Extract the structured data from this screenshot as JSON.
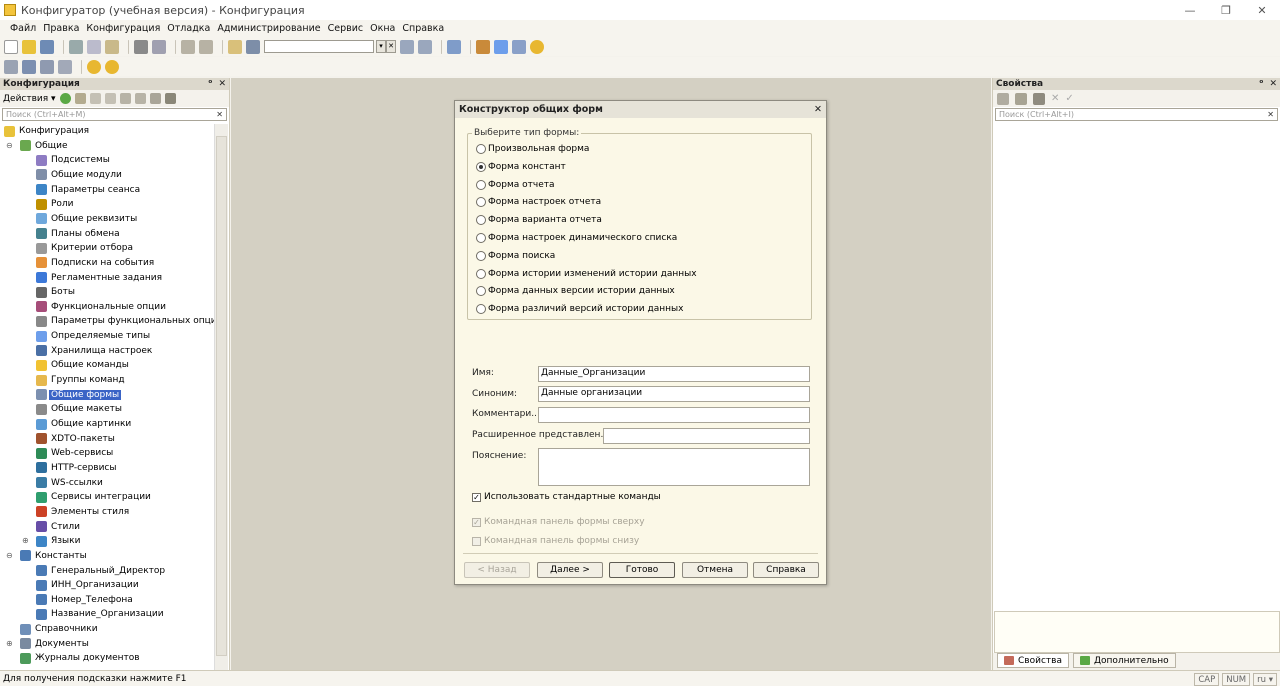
{
  "app": {
    "title": "Конфигуратор (учебная версия) - Конфигурация",
    "controls": [
      "—",
      "❐",
      "✕"
    ]
  },
  "menu": [
    "Файл",
    "Правка",
    "Конфигурация",
    "Отладка",
    "Администрирование",
    "Сервис",
    "Окна",
    "Справка"
  ],
  "left_panel": {
    "title": "Конфигурация",
    "actions_label": "Действия ▾",
    "search_placeholder": "Поиск (Ctrl+Alt+M)",
    "tree": [
      {
        "label": "Конфигурация",
        "level": 0,
        "icon": "config-icon",
        "color": "#e8c23a"
      },
      {
        "label": "Общие",
        "level": 1,
        "icon": "common-icon",
        "color": "#6aa84f",
        "exp": "⊖"
      },
      {
        "label": "Подсистемы",
        "level": 2,
        "icon": "subsystems-icon",
        "color": "#8e7cc3"
      },
      {
        "label": "Общие модули",
        "level": 2,
        "icon": "module-icon",
        "color": "#7f8ea8"
      },
      {
        "label": "Параметры сеанса",
        "level": 2,
        "icon": "session-params-icon",
        "color": "#3d85c6"
      },
      {
        "label": "Роли",
        "level": 2,
        "icon": "roles-icon",
        "color": "#bf9000"
      },
      {
        "label": "Общие реквизиты",
        "level": 2,
        "icon": "attributes-icon",
        "color": "#6fa8dc"
      },
      {
        "label": "Планы обмена",
        "level": 2,
        "icon": "exchange-icon",
        "color": "#45818e"
      },
      {
        "label": "Критерии отбора",
        "level": 2,
        "icon": "filter-criteria-icon",
        "color": "#999999"
      },
      {
        "label": "Подписки на события",
        "level": 2,
        "icon": "subscriptions-icon",
        "color": "#e69138"
      },
      {
        "label": "Регламентные задания",
        "level": 2,
        "icon": "scheduled-jobs-icon",
        "color": "#3c78d8"
      },
      {
        "label": "Боты",
        "level": 2,
        "icon": "bots-icon",
        "color": "#666666"
      },
      {
        "label": "Функциональные опции",
        "level": 2,
        "icon": "functional-options-icon",
        "color": "#a64d79"
      },
      {
        "label": "Параметры функциональных опций",
        "level": 2,
        "icon": "fo-params-icon",
        "color": "#888888"
      },
      {
        "label": "Определяемые типы",
        "level": 2,
        "icon": "defined-types-icon",
        "color": "#6d9eeb"
      },
      {
        "label": "Хранилища настроек",
        "level": 2,
        "icon": "settings-storage-icon",
        "color": "#4a6fa5"
      },
      {
        "label": "Общие команды",
        "level": 2,
        "icon": "commands-icon",
        "color": "#f1c232"
      },
      {
        "label": "Группы команд",
        "level": 2,
        "icon": "command-groups-icon",
        "color": "#e6b84d"
      },
      {
        "label": "Общие формы",
        "level": 2,
        "icon": "forms-icon",
        "color": "#7c90b0",
        "selected": true
      },
      {
        "label": "Общие макеты",
        "level": 2,
        "icon": "templates-icon",
        "color": "#8a8a8a"
      },
      {
        "label": "Общие картинки",
        "level": 2,
        "icon": "pictures-icon",
        "color": "#5b9bd5"
      },
      {
        "label": "XDTO-пакеты",
        "level": 2,
        "icon": "xdto-icon",
        "color": "#a0522d"
      },
      {
        "label": "Web-сервисы",
        "level": 2,
        "icon": "web-services-icon",
        "color": "#2e8b57"
      },
      {
        "label": "HTTP-сервисы",
        "level": 2,
        "icon": "http-services-icon",
        "color": "#2e6f9e"
      },
      {
        "label": "WS-ссылки",
        "level": 2,
        "icon": "ws-links-icon",
        "color": "#3a7ca5"
      },
      {
        "label": "Сервисы интеграции",
        "level": 2,
        "icon": "integration-icon",
        "color": "#2f9e6e"
      },
      {
        "label": "Элементы стиля",
        "level": 2,
        "icon": "style-items-icon",
        "color": "#cc4125"
      },
      {
        "label": "Стили",
        "level": 2,
        "icon": "styles-icon",
        "color": "#674ea7"
      },
      {
        "label": "Языки",
        "level": 2,
        "icon": "languages-icon",
        "color": "#3d85c6",
        "exp": "⊕"
      },
      {
        "label": "Константы",
        "level": 1,
        "icon": "constants-icon",
        "color": "#4a7ab5",
        "exp": "⊖"
      },
      {
        "label": "Генеральный_Директор",
        "level": 2,
        "icon": "constant-icon",
        "color": "#4a7ab5"
      },
      {
        "label": "ИНН_Организации",
        "level": 2,
        "icon": "constant-icon",
        "color": "#4a7ab5"
      },
      {
        "label": "Номер_Телефона",
        "level": 2,
        "icon": "constant-icon",
        "color": "#4a7ab5"
      },
      {
        "label": "Название_Организации",
        "level": 2,
        "icon": "constant-icon",
        "color": "#4a7ab5"
      },
      {
        "label": "Справочники",
        "level": 1,
        "icon": "catalogs-icon",
        "color": "#6f8fb8"
      },
      {
        "label": "Документы",
        "level": 1,
        "icon": "documents-icon",
        "color": "#7a8aa0",
        "exp": "⊕"
      },
      {
        "label": "Журналы документов",
        "level": 1,
        "icon": "journals-icon",
        "color": "#4c9a5a"
      }
    ]
  },
  "right_panel": {
    "title": "Свойства",
    "search_placeholder": "Поиск (Ctrl+Alt+I)",
    "tabs": [
      {
        "label": "Свойства",
        "active": true
      },
      {
        "label": "Дополнительно",
        "active": false
      }
    ]
  },
  "dialog": {
    "title": "Конструктор общих форм",
    "group_title": "Выберите тип формы:",
    "selected_index": 1,
    "form_types": [
      "Произвольная форма",
      "Форма констант",
      "Форма отчета",
      "Форма настроек отчета",
      "Форма варианта отчета",
      "Форма настроек динамического списка",
      "Форма поиска",
      "Форма истории изменений истории данных",
      "Форма данных версии истории данных",
      "Форма различий версий истории данных"
    ],
    "fields": {
      "name_label": "Имя:",
      "name_value": "Данные_Организации",
      "synonym_label": "Синоним:",
      "synonym_value": "Данные организации",
      "comment_label": "Комментари..",
      "comment_value": "",
      "extended_label": "Расширенное представлен..",
      "extended_value": "",
      "explanation_label": "Пояснение:",
      "explanation_value": ""
    },
    "checkboxes": {
      "standard_commands": {
        "label": "Использовать стандартные команды",
        "checked": true
      },
      "panel_top": {
        "label": "Командная панель формы сверху",
        "checked": true,
        "disabled": true
      },
      "panel_bottom": {
        "label": "Командная панель формы снизу",
        "checked": false,
        "disabled": true
      }
    },
    "buttons": {
      "back": "< Назад",
      "next": "Далее >",
      "done": "Готово",
      "cancel": "Отмена",
      "help": "Справка"
    }
  },
  "status": {
    "hint": "Для получения подсказки нажмите F1",
    "keys": [
      "CAP",
      "NUM",
      "ru ▾"
    ]
  }
}
